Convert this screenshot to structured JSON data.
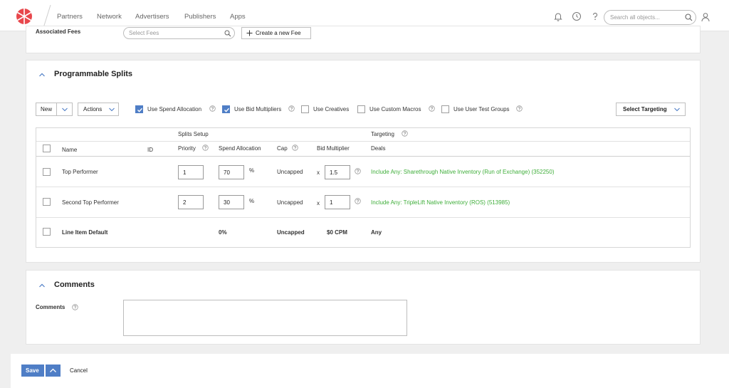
{
  "nav": {
    "items": [
      "Partners",
      "Network",
      "Advertisers",
      "Publishers",
      "Apps"
    ],
    "search_placeholder": "Search all objects..."
  },
  "fees": {
    "label": "Associated Fees",
    "select_placeholder": "Select Fees",
    "create_label": "Create a new Fee"
  },
  "splits": {
    "title": "Programmable Splits",
    "toolbar": {
      "new_label": "New",
      "actions_label": "Actions",
      "options": [
        {
          "label": "Use Spend Allocation",
          "checked": true
        },
        {
          "label": "Use Bid Multipliers",
          "checked": true
        },
        {
          "label": "Use Creatives",
          "checked": false
        },
        {
          "label": "Use Custom Macros",
          "checked": false
        },
        {
          "label": "Use User Test Groups",
          "checked": false
        }
      ],
      "targeting_button": "Select Targeting"
    },
    "table": {
      "group_headers": {
        "setup": "Splits Setup",
        "targeting": "Targeting"
      },
      "columns": {
        "name": "Name",
        "id": "ID",
        "priority": "Priority",
        "spend": "Spend Allocation",
        "cap": "Cap",
        "bid": "Bid Multiplier",
        "deals": "Deals"
      },
      "rows": [
        {
          "name": "Top Performer",
          "priority": "1",
          "spend": "70",
          "unit": "%",
          "cap": "Uncapped",
          "x": "x",
          "bid": "1.5",
          "deals": "Include Any: Sharethrough Native Inventory (Run of Exchange) (352250)"
        },
        {
          "name": "Second Top Performer",
          "priority": "2",
          "spend": "30",
          "unit": "%",
          "cap": "Uncapped",
          "x": "x",
          "bid": "1",
          "deals": "Include Any: TripleLift Native Inventory (ROS) (513985)"
        }
      ],
      "default_row": {
        "name": "Line Item Default",
        "spend": "0%",
        "cap": "Uncapped",
        "bid": "$0 CPM",
        "deals": "Any"
      }
    }
  },
  "comments": {
    "title": "Comments",
    "label": "Comments",
    "value": ""
  },
  "footer": {
    "save_label": "Save",
    "cancel_label": "Cancel"
  },
  "colors": {
    "accent": "#4f7ec6",
    "deal_text": "#3fae3a",
    "logo": "#e8474c"
  }
}
